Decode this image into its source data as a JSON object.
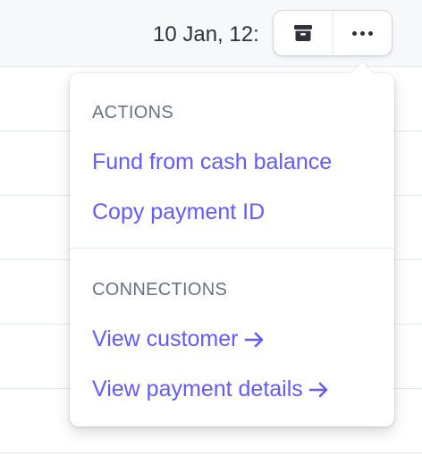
{
  "row": {
    "date": "10 Jan, 12:"
  },
  "button_group": {
    "archive_icon": "archive-icon",
    "more_icon": "more-horizontal-icon"
  },
  "menu": {
    "actions_header": "ACTIONS",
    "actions": [
      {
        "label": "Fund from cash balance"
      },
      {
        "label": "Copy payment ID"
      }
    ],
    "connections_header": "CONNECTIONS",
    "connections": [
      {
        "label": "View customer",
        "icon": "arrow-right-icon"
      },
      {
        "label": "View payment details",
        "icon": "arrow-right-icon"
      }
    ]
  },
  "colors": {
    "accent": "#635bff",
    "header_text": "#687385",
    "body_text": "#30313d",
    "border": "#e3e8ee"
  }
}
